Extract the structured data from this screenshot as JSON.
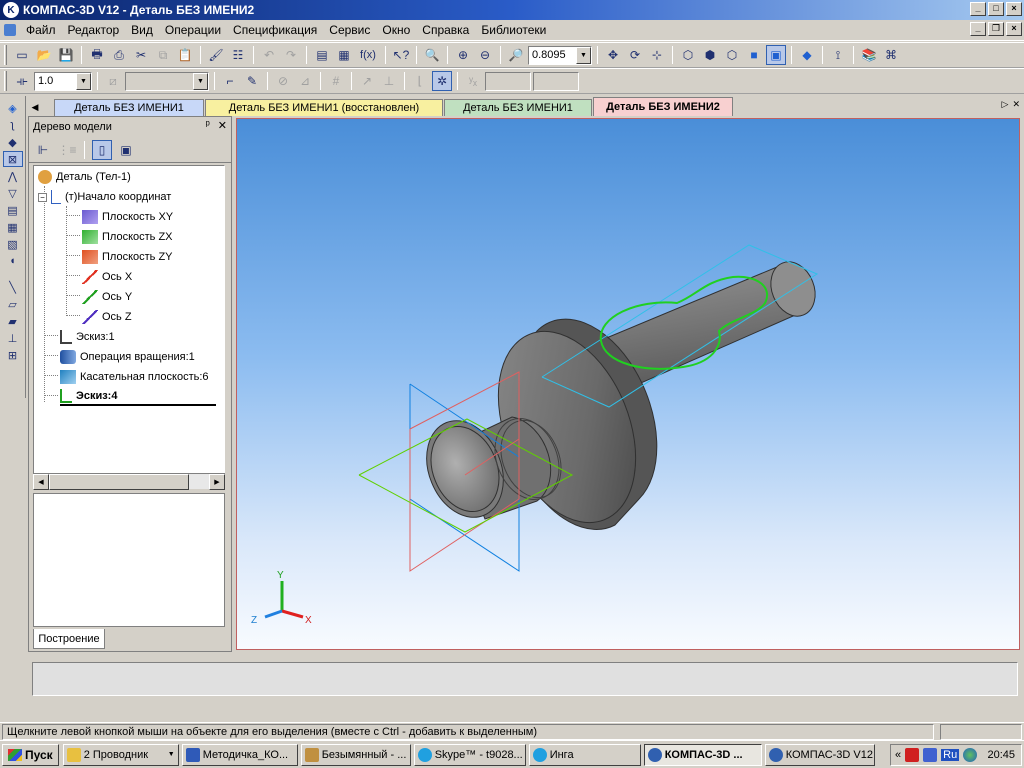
{
  "window": {
    "title": "КОМПАС-3D V12 - Деталь БЕЗ ИМЕНИ2",
    "logo": "K"
  },
  "menu": {
    "items": [
      "Файл",
      "Редактор",
      "Вид",
      "Операции",
      "Спецификация",
      "Сервис",
      "Окно",
      "Справка",
      "Библиотеки"
    ]
  },
  "toolbar": {
    "zoom_value": "0.8095",
    "fx_label": "f(x)",
    "step_value": "1.0",
    "icons": [
      "new-icon",
      "open-icon",
      "save-icon",
      "print-icon",
      "preview-icon",
      "cut-icon",
      "copy-icon",
      "paste-icon",
      "brush-icon",
      "properties-icon",
      "undo-icon",
      "redo-icon",
      "manager-icon",
      "variables-icon",
      "help-icon",
      "zoom-window-icon",
      "zoom-in-icon",
      "zoom-out-icon",
      "pan-icon",
      "rotate-icon",
      "orient-icon",
      "wireframe-icon",
      "hidden-lines-icon",
      "shaded-icon",
      "shaded-edges-icon",
      "perspective-icon"
    ]
  },
  "tabs": [
    {
      "label": "Деталь БЕЗ ИМЕНИ1",
      "color": "#c8d8f8"
    },
    {
      "label": "Деталь БЕЗ ИМЕНИ1 (восстановлен)",
      "color": "#f8f0a0"
    },
    {
      "label": "Деталь БЕЗ ИМЕНИ1",
      "color": "#c0e0c0"
    },
    {
      "label": "Деталь БЕЗ ИМЕНИ2",
      "color": "#f8d0d0"
    }
  ],
  "tree_panel": {
    "title": "Дерево модели",
    "pin": "ᵖ",
    "close": "✕",
    "bottom_tab": "Построение",
    "items": [
      {
        "label": "Деталь (Тел-1)",
        "icon": "part-icon"
      },
      {
        "label": "(т)Начало координат",
        "icon": "origin-icon"
      },
      {
        "label": "Плоскость XY",
        "icon": "plane-xy-icon"
      },
      {
        "label": "Плоскость ZX",
        "icon": "plane-zx-icon"
      },
      {
        "label": "Плоскость ZY",
        "icon": "plane-zy-icon"
      },
      {
        "label": "Ось X",
        "icon": "axis-x-icon"
      },
      {
        "label": "Ось Y",
        "icon": "axis-y-icon"
      },
      {
        "label": "Ось Z",
        "icon": "axis-z-icon"
      },
      {
        "label": "Эскиз:1",
        "icon": "sketch-icon"
      },
      {
        "label": "Операция вращения:1",
        "icon": "revolve-icon"
      },
      {
        "label": "Касательная плоскость:6",
        "icon": "tangent-plane-icon"
      },
      {
        "label": "Эскиз:4",
        "icon": "sketch-active-icon"
      }
    ]
  },
  "axes": {
    "x": "X",
    "y": "Y",
    "z": "Z"
  },
  "status": {
    "text": "Щелкните левой кнопкой мыши на объекте для его выделения (вместе с Ctrl - добавить к выделенным)"
  },
  "taskbar": {
    "start": "Пуск",
    "tasks": [
      {
        "label": "2 Проводник",
        "color": "#e8c040"
      },
      {
        "label": "Методичка_КО...",
        "color": "#2f5ab8"
      },
      {
        "label": "Безымянный - ...",
        "color": "#c09040"
      },
      {
        "label": "Skype™ - t9028...",
        "color": "#20a0e0"
      },
      {
        "label": "Инга",
        "color": "#20a0e0"
      },
      {
        "label": "КОМПАС-3D ...",
        "color": "#3060b0"
      },
      {
        "label": "КОМПАС-3D V12",
        "color": "#3060b0"
      }
    ],
    "tray_lang": "Ru",
    "time": "20:45"
  }
}
